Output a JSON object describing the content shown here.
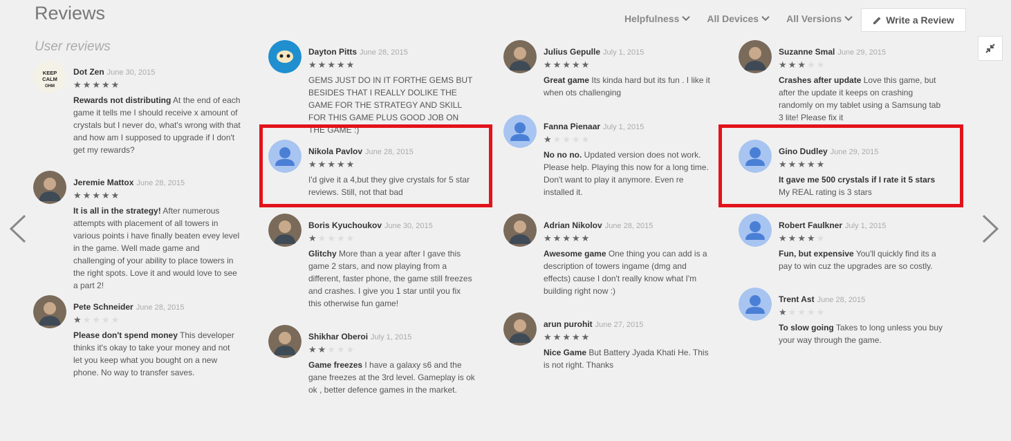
{
  "page": {
    "title": "Reviews",
    "subtitle": "User reviews",
    "filters": [
      "Helpfulness",
      "All Devices",
      "All Versions"
    ],
    "write_review": "Write a Review"
  },
  "colors": {
    "highlight": "#e3131b",
    "star_on": "#666666",
    "star_off": "#dddddd",
    "default_avatar": "#a8c4f0"
  },
  "columns": [
    {
      "reviews": [
        {
          "author": "Dot Zen",
          "date": "June 30, 2015",
          "rating": 5,
          "title": "Rewards not distributing",
          "text": "At the end of each game it tells me I should receive x amount of crystals but I never do, what's wrong with that and how am I supposed to upgrade if I don't get my rewards?",
          "avatar": "keep-calm-avatar"
        },
        {
          "author": "Jeremie Mattox",
          "date": "June 28, 2015",
          "rating": 5,
          "title": "It is all in the strategy!",
          "text": "After numerous attempts with placement of all towers in various points i have finally beaten evey level in the game. Well made game and challenging of your ability to place towers in the right spots. Love it and would love to see a part 2!",
          "avatar": "photo-avatar"
        },
        {
          "author": "Pete Schneider",
          "date": "June 28, 2015",
          "rating": 1,
          "title": "Please don't spend money",
          "text": "This developer thinks it's okay to take your money and not let you keep what you bought on a new phone. No way to transfer saves.",
          "avatar": "photo-avatar"
        }
      ]
    },
    {
      "reviews": [
        {
          "author": "Dayton Pitts",
          "date": "June 28, 2015",
          "rating": 5,
          "title": "",
          "text": "GEMS JUST DO IN IT FORTHE GEMS BUT BESIDES THAT I REALLY DOLIKE THE GAME FOR THE STRATEGY AND SKILL FOR THIS GAME PLUS GOOD JOB ON THE GAME :)",
          "avatar": "cartoon-avatar"
        },
        {
          "author": "Nikola Pavlov",
          "date": "June 28, 2015",
          "rating": 5,
          "title": "",
          "text": "I'd give it a 4,but they give crystals for 5 star reviews. Still, not that bad",
          "avatar": "default-avatar"
        },
        {
          "author": "Boris Kyuchoukov",
          "date": "June 30, 2015",
          "rating": 1,
          "title": "Glitchy",
          "text": "More than a year after I gave this game 2 stars, and now playing from a different, faster phone, the game still freezes and crashes. I give you 1 star until you fix this otherwise fun game!",
          "avatar": "photo-avatar"
        },
        {
          "author": "Shikhar Oberoi",
          "date": "July 1, 2015",
          "rating": 2,
          "title": "Game freezes",
          "text": "I have a galaxy s6 and the gane freezes at the 3rd level. Gameplay is ok ok , better defence games in the market.",
          "avatar": "photo-avatar"
        }
      ]
    },
    {
      "reviews": [
        {
          "author": "Julius Gepulle",
          "date": "July 1, 2015",
          "rating": 5,
          "title": "Great game",
          "text": "Its kinda hard but its fun . I like it when ots challenging",
          "avatar": "photo-avatar"
        },
        {
          "author": "Fanna Pienaar",
          "date": "July 1, 2015",
          "rating": 1,
          "title": "No no no.",
          "text": "Updated version does not work. Please help. Playing this now for a long time. Don't want to play it anymore. Even re installed it.",
          "avatar": "default-avatar"
        },
        {
          "author": "Adrian Nikolov",
          "date": "June 28, 2015",
          "rating": 5,
          "title": "Awesome game",
          "text": "One thing you can add is a description of towers ingame (dmg and effects) cause I don't really know what I'm building right now :)",
          "avatar": "photo-avatar"
        },
        {
          "author": "arun purohit",
          "date": "June 27, 2015",
          "rating": 5,
          "title": "Nice Game",
          "text": "But Battery Jyada Khati He. This is not right. Thanks",
          "avatar": "photo-avatar"
        }
      ]
    },
    {
      "reviews": [
        {
          "author": "Suzanne Smal",
          "date": "June 29, 2015",
          "rating": 3,
          "title": "Crashes after update",
          "text": "Love this game, but after the update it keeps on crashing randomly on my tablet using a Samsung tab 3 lite! Please fix it",
          "avatar": "photo-avatar"
        },
        {
          "author": "Gino Dudley",
          "date": "June 29, 2015",
          "rating": 5,
          "title": "It gave me 500 crystals if I rate it 5 stars",
          "text": "My REAL rating is 3 stars",
          "avatar": "default-avatar"
        },
        {
          "author": "Robert Faulkner",
          "date": "July 1, 2015",
          "rating": 4,
          "title": "Fun, but expensive",
          "text": "You'll quickly find its a pay to win cuz the upgrades are so costly.",
          "avatar": "default-avatar"
        },
        {
          "author": "Trent Ast",
          "date": "June 28, 2015",
          "rating": 1,
          "title": "To slow going",
          "text": "Takes to long unless you buy your way through the game.",
          "avatar": "default-avatar"
        }
      ]
    }
  ]
}
